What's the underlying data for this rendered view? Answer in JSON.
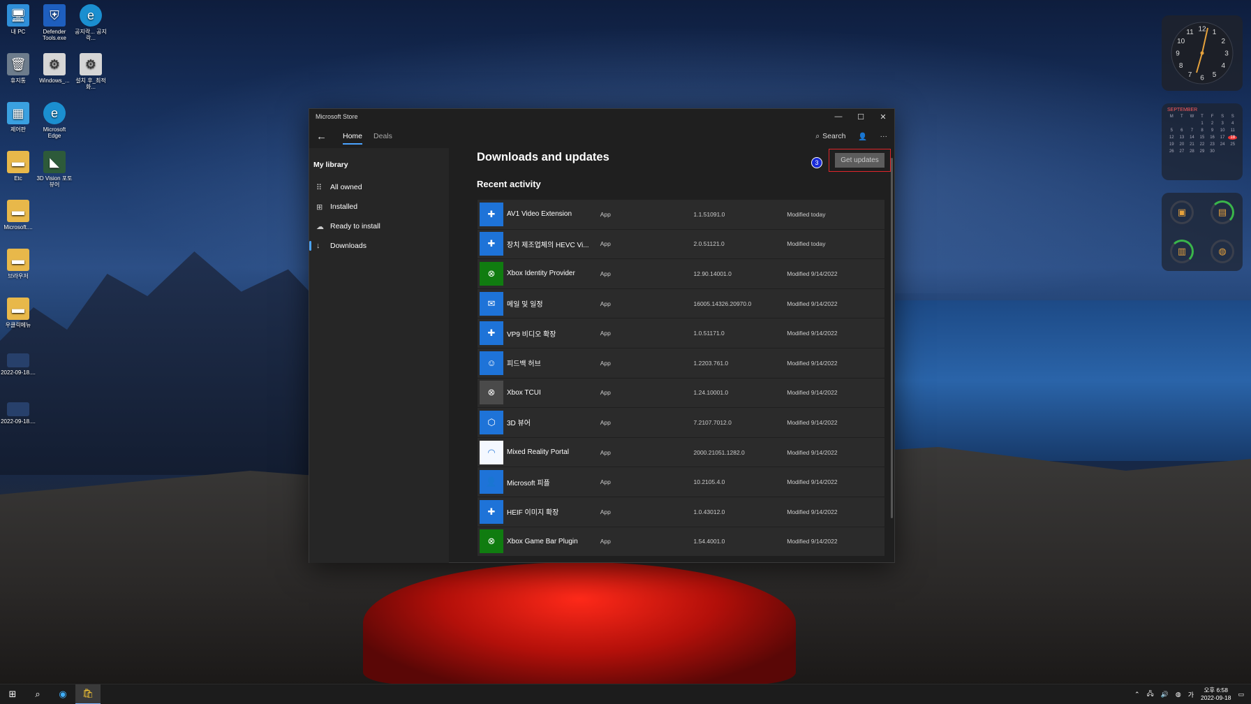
{
  "desktop_icons": [
    {
      "label": "내 PC",
      "icon": "monitor-icon"
    },
    {
      "label": "Defender Tools.exe",
      "icon": "shield-icon"
    },
    {
      "label": "공지락... 공지락...",
      "icon": "edge-icon"
    },
    {
      "label": "휴지통",
      "icon": "recycle-bin-icon"
    },
    {
      "label": "Windows_...",
      "icon": "gear-icon"
    },
    {
      "label": "설치 후_최적화...",
      "icon": "gear-icon"
    },
    {
      "label": "제어판",
      "icon": "control-panel-icon"
    },
    {
      "label": "Microsoft Edge",
      "icon": "edge-icon"
    },
    {
      "label": "Etc",
      "icon": "folder-icon"
    },
    {
      "label": "3D Vision 포토 뷰어",
      "icon": "nvidia-icon"
    },
    {
      "label": "Microsoft....",
      "icon": "folder-icon"
    },
    {
      "label": "브라우저",
      "icon": "folder-icon"
    },
    {
      "label": "우클릭메뉴",
      "icon": "folder-icon"
    },
    {
      "label": "2022-09-18....",
      "icon": "image-file-icon"
    },
    {
      "label": "2022-09-18....",
      "icon": "image-file-icon"
    }
  ],
  "widgets": {
    "clock_numbers": [
      "12",
      "1",
      "2",
      "3",
      "4",
      "5",
      "6",
      "7",
      "8",
      "9",
      "10",
      "11"
    ],
    "calendar_month": "SEPTEMBER",
    "calendar_weekdays": [
      "M",
      "T",
      "W",
      "T",
      "F",
      "S",
      "S"
    ],
    "calendar_days": [
      "",
      "",
      "",
      "1",
      "2",
      "3",
      "4",
      "5",
      "6",
      "7",
      "8",
      "9",
      "10",
      "11",
      "12",
      "13",
      "14",
      "15",
      "16",
      "17",
      "18",
      "19",
      "20",
      "21",
      "22",
      "23",
      "24",
      "25",
      "26",
      "27",
      "28",
      "29",
      "30",
      "",
      ""
    ],
    "calendar_today": "18"
  },
  "store": {
    "window_title": "Microsoft Store",
    "tabs": [
      {
        "label": "Home",
        "active": true
      },
      {
        "label": "Deals",
        "active": false
      }
    ],
    "search_label": "Search",
    "sidebar": {
      "heading": "My library",
      "items": [
        {
          "label": "All owned",
          "icon": "grid-icon",
          "active": false
        },
        {
          "label": "Installed",
          "icon": "installed-icon",
          "active": false
        },
        {
          "label": "Ready to install",
          "icon": "cloud-download-icon",
          "active": false
        },
        {
          "label": "Downloads",
          "icon": "download-icon",
          "active": true
        }
      ]
    },
    "page_title": "Downloads and updates",
    "step_badge": "3",
    "get_updates_label": "Get updates",
    "section_title": "Recent activity",
    "rows": [
      {
        "name": "AV1 Video Extension",
        "type": "App",
        "version": "1.1.51091.0",
        "modified": "Modified today",
        "icon_color": "#1e73d8",
        "icon": "puzzle-icon",
        "glyph": "✚"
      },
      {
        "name": "장치 제조업체의 HEVC Vi...",
        "type": "App",
        "version": "2.0.51121.0",
        "modified": "Modified today",
        "icon_color": "#1e73d8",
        "icon": "puzzle-icon",
        "glyph": "✚"
      },
      {
        "name": "Xbox Identity Provider",
        "type": "App",
        "version": "12.90.14001.0",
        "modified": "Modified 9/14/2022",
        "icon_color": "#107c10",
        "icon": "xbox-icon",
        "glyph": "⊗"
      },
      {
        "name": "메일 및 일정",
        "type": "App",
        "version": "16005.14326.20970.0",
        "modified": "Modified 9/14/2022",
        "icon_color": "#1e73d8",
        "icon": "mail-icon",
        "glyph": "✉"
      },
      {
        "name": "VP9 비디오 확장",
        "type": "App",
        "version": "1.0.51171.0",
        "modified": "Modified 9/14/2022",
        "icon_color": "#1e73d8",
        "icon": "puzzle-icon",
        "glyph": "✚"
      },
      {
        "name": "피드백 허브",
        "type": "App",
        "version": "1.2203.761.0",
        "modified": "Modified 9/14/2022",
        "icon_color": "#1e73d8",
        "icon": "feedback-icon",
        "glyph": "☺"
      },
      {
        "name": "Xbox TCUI",
        "type": "App",
        "version": "1.24.10001.0",
        "modified": "Modified 9/14/2022",
        "icon_color": "#4a4a4a",
        "icon": "xbox-icon",
        "glyph": "⊗"
      },
      {
        "name": "3D 뷰어",
        "type": "App",
        "version": "7.2107.7012.0",
        "modified": "Modified 9/14/2022",
        "icon_color": "#1e73d8",
        "icon": "cube-icon",
        "glyph": "⬡"
      },
      {
        "name": "Mixed Reality Portal",
        "type": "App",
        "version": "2000.21051.1282.0",
        "modified": "Modified 9/14/2022",
        "icon_color": "#f4f8ff",
        "icon": "headset-icon",
        "glyph": "◠"
      },
      {
        "name": "Microsoft 피플",
        "type": "App",
        "version": "10.2105.4.0",
        "modified": "Modified 9/14/2022",
        "icon_color": "#1e73d8",
        "icon": "people-icon",
        "glyph": "👤"
      },
      {
        "name": "HEIF 이미지 확장",
        "type": "App",
        "version": "1.0.43012.0",
        "modified": "Modified 9/14/2022",
        "icon_color": "#1e73d8",
        "icon": "puzzle-icon",
        "glyph": "✚"
      },
      {
        "name": "Xbox Game Bar Plugin",
        "type": "App",
        "version": "1.54.4001.0",
        "modified": "Modified 9/14/2022",
        "icon_color": "#107c10",
        "icon": "xbox-icon",
        "glyph": "⊗"
      }
    ]
  },
  "taskbar": {
    "time": "오후 6:58",
    "date": "2022-09-18"
  }
}
